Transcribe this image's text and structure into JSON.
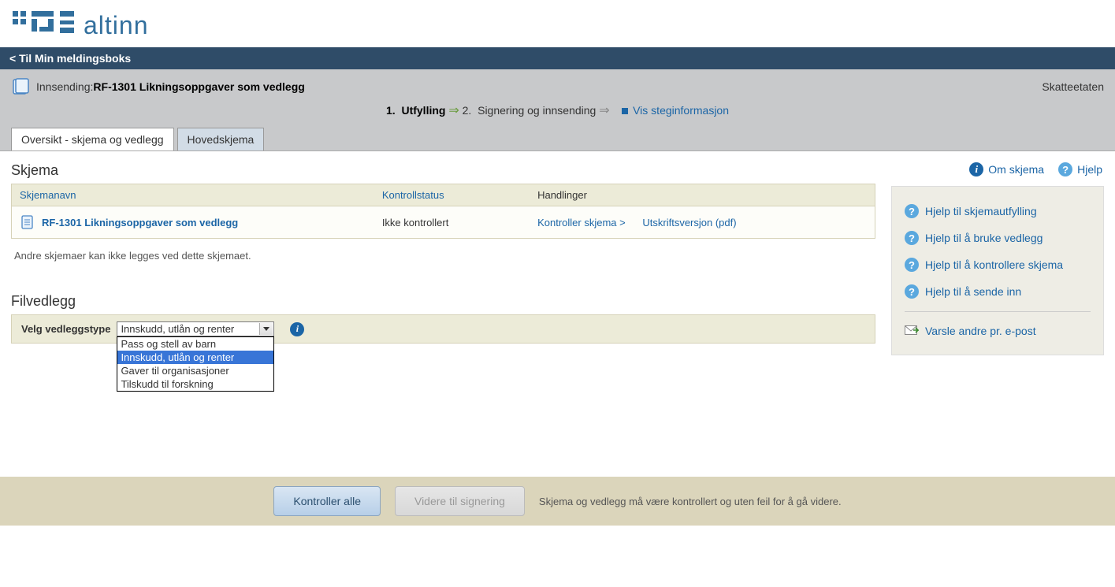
{
  "logo": {
    "text": "altinn"
  },
  "nav": {
    "back": "Til Min meldingsboks"
  },
  "subheader": {
    "innsending_prefix": "Innsending:",
    "innsending_title": "RF-1301 Likningsoppgaver som vedlegg",
    "etat": "Skatteetaten"
  },
  "steps": {
    "step1_num": "1.",
    "step1_label": "Utfylling",
    "step2_num": "2.",
    "step2_label": "Signering og innsending",
    "show_info": "Vis steginformasjon"
  },
  "tabs": {
    "overview": "Oversikt - skjema og vedlegg",
    "main": "Hovedskjema"
  },
  "skjema": {
    "heading": "Skjema",
    "headers": {
      "name": "Skjemanavn",
      "status": "Kontrollstatus",
      "actions": "Handlinger"
    },
    "row": {
      "name": "RF-1301 Likningsoppgaver som vedlegg",
      "status": "Ikke kontrollert",
      "action_check": "Kontroller skjema >",
      "action_print": "Utskriftsversjon (pdf)"
    },
    "note": "Andre skjemaer kan ikke legges ved dette skjemaet."
  },
  "filvedlegg": {
    "heading": "Filvedlegg",
    "label": "Velg vedleggstype",
    "selected": "Innskudd, utlån og renter",
    "options": [
      "Pass og stell av barn",
      "Innskudd, utlån og renter",
      "Gaver til organisasjoner",
      "Tilskudd til forskning"
    ]
  },
  "top_links": {
    "about": "Om skjema",
    "help": "Hjelp"
  },
  "side_links": {
    "fill": "Hjelp til skjemautfylling",
    "attach": "Hjelp til å bruke vedlegg",
    "check": "Hjelp til å kontrollere skjema",
    "send": "Hjelp til å sende inn",
    "notify": "Varsle andre pr. e-post"
  },
  "footer": {
    "check_all": "Kontroller alle",
    "next": "Videre til signering",
    "note": "Skjema og vedlegg må være kontrollert og uten feil for å gå videre."
  }
}
